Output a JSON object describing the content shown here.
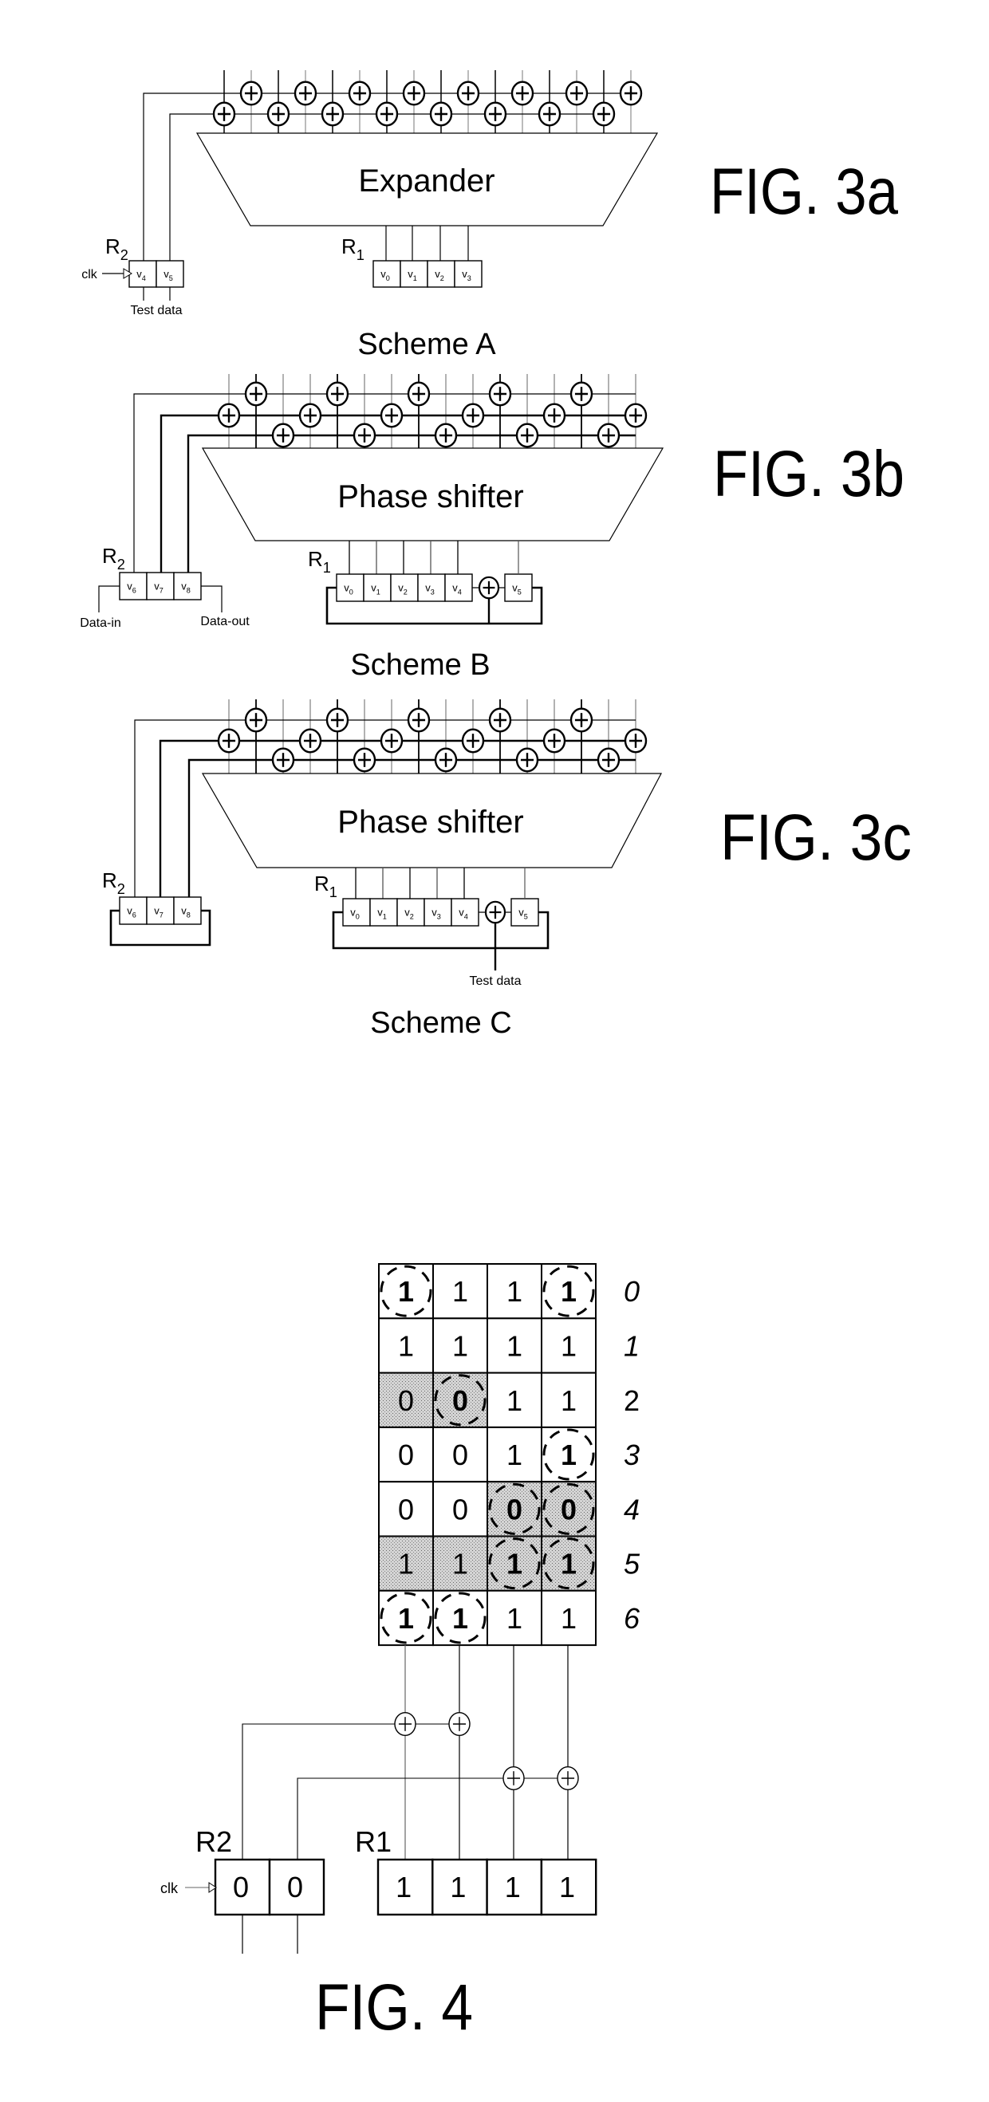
{
  "figures": {
    "fig3a": {
      "label": "FIG. 3a",
      "caption": "Scheme A",
      "block": "Expander",
      "r1": {
        "label": "R",
        "sub": "1",
        "cells": [
          {
            "v": "v",
            "s": "0"
          },
          {
            "v": "v",
            "s": "1"
          },
          {
            "v": "v",
            "s": "2"
          },
          {
            "v": "v",
            "s": "3"
          }
        ]
      },
      "r2": {
        "label": "R",
        "sub": "2",
        "cells": [
          {
            "v": "v",
            "s": "4"
          },
          {
            "v": "v",
            "s": "5"
          }
        ]
      },
      "clk": "clk",
      "test_data": "Test data",
      "xor_symbol": "⊕"
    },
    "fig3b": {
      "label": "FIG. 3b",
      "caption": "Scheme B",
      "block": "Phase shifter",
      "r1": {
        "label": "R",
        "sub": "1",
        "cells": [
          {
            "v": "v",
            "s": "0"
          },
          {
            "v": "v",
            "s": "1"
          },
          {
            "v": "v",
            "s": "2"
          },
          {
            "v": "v",
            "s": "3"
          },
          {
            "v": "v",
            "s": "4"
          }
        ],
        "tail": {
          "v": "v",
          "s": "5"
        }
      },
      "r2": {
        "label": "R",
        "sub": "2",
        "cells": [
          {
            "v": "v",
            "s": "6"
          },
          {
            "v": "v",
            "s": "7"
          },
          {
            "v": "v",
            "s": "8"
          }
        ]
      },
      "data_in": "Data-in",
      "data_out": "Data-out"
    },
    "fig3c": {
      "label": "FIG. 3c",
      "caption": "Scheme C",
      "block": "Phase shifter",
      "r1": {
        "label": "R",
        "sub": "1",
        "cells": [
          {
            "v": "v",
            "s": "0"
          },
          {
            "v": "v",
            "s": "1"
          },
          {
            "v": "v",
            "s": "2"
          },
          {
            "v": "v",
            "s": "3"
          },
          {
            "v": "v",
            "s": "4"
          }
        ],
        "tail": {
          "v": "v",
          "s": "5"
        }
      },
      "r2": {
        "label": "R",
        "sub": "2",
        "cells": [
          {
            "v": "v",
            "s": "6"
          },
          {
            "v": "v",
            "s": "7"
          },
          {
            "v": "v",
            "s": "8"
          }
        ]
      },
      "test_data": "Test data"
    },
    "fig4": {
      "label": "FIG. 4",
      "grid": [
        [
          "1",
          "1",
          "1",
          "1"
        ],
        [
          "1",
          "1",
          "1",
          "1"
        ],
        [
          "0",
          "0",
          "1",
          "1"
        ],
        [
          "0",
          "0",
          "1",
          "1"
        ],
        [
          "0",
          "0",
          "0",
          "0"
        ],
        [
          "1",
          "1",
          "1",
          "1"
        ],
        [
          "1",
          "1",
          "1",
          "1"
        ]
      ],
      "shaded": [
        [
          2,
          0
        ],
        [
          2,
          1
        ],
        [
          4,
          2
        ],
        [
          4,
          3
        ],
        [
          5,
          0
        ],
        [
          5,
          1
        ],
        [
          5,
          2
        ],
        [
          5,
          3
        ]
      ],
      "circled": [
        [
          0,
          0
        ],
        [
          0,
          3
        ],
        [
          2,
          1
        ],
        [
          3,
          3
        ],
        [
          4,
          2
        ],
        [
          4,
          3
        ],
        [
          5,
          2
        ],
        [
          5,
          3
        ],
        [
          6,
          0
        ],
        [
          6,
          1
        ]
      ],
      "row_labels": [
        "0",
        "1",
        "2",
        "3",
        "4",
        "5",
        "6"
      ],
      "r1": {
        "label": "R1",
        "cells": [
          "1",
          "1",
          "1",
          "1"
        ]
      },
      "r2": {
        "label": "R2",
        "cells": [
          "0",
          "0"
        ]
      },
      "clk": "clk"
    }
  },
  "colors": {
    "ink": "#000000",
    "shade": "#c8c8c8",
    "paper": "#ffffff"
  }
}
